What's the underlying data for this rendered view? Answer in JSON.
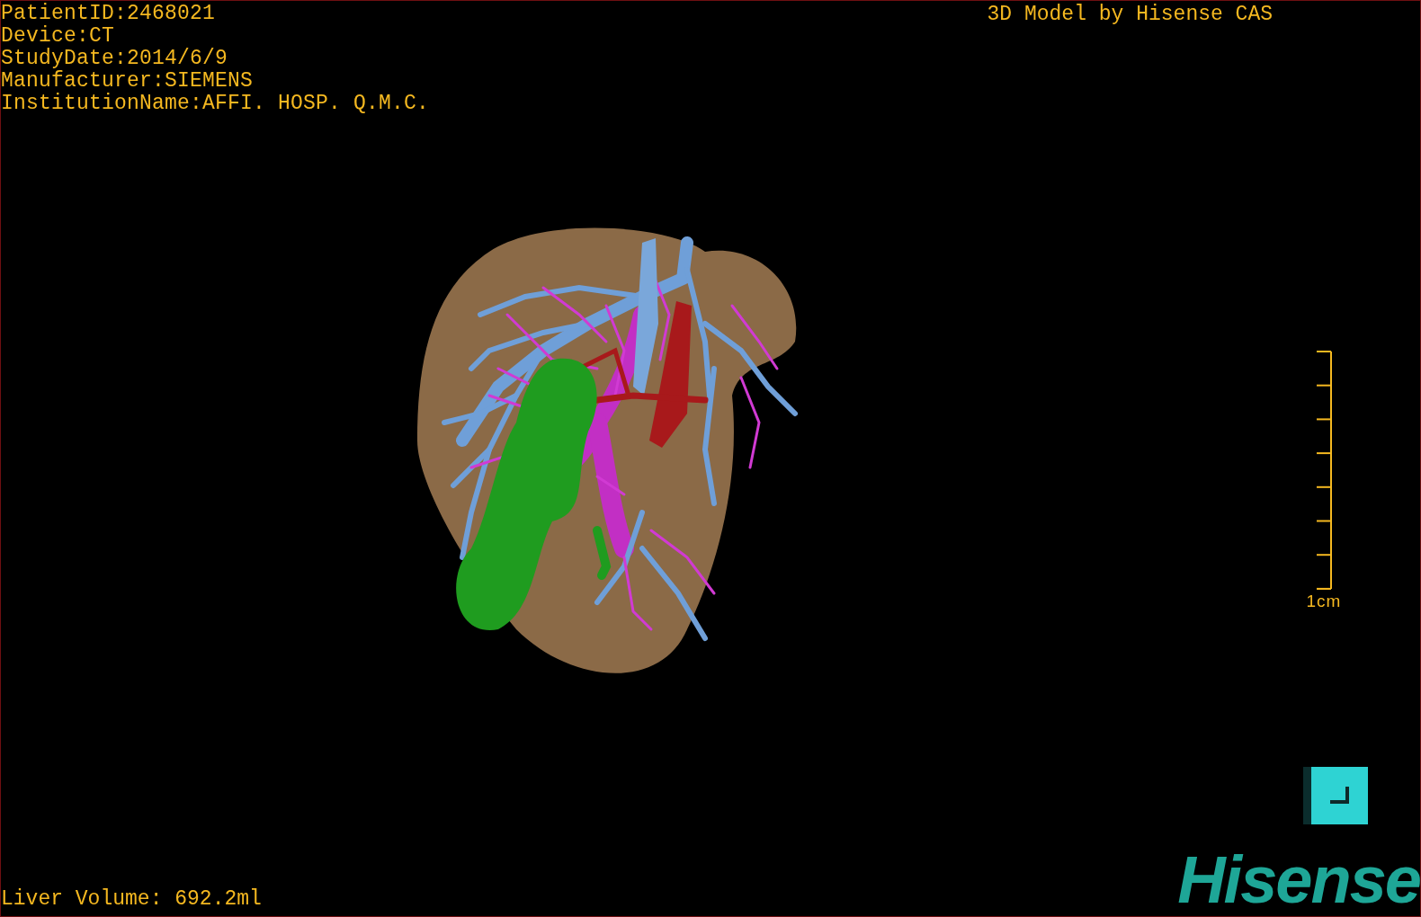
{
  "patient_info": [
    "PatientID:2468021",
    "Device:CT",
    "StudyDate:2014/6/9",
    "Manufacturer:SIEMENS",
    "InstitutionName:AFFI. HOSP. Q.M.C."
  ],
  "title": "3D Model by Hisense CAS",
  "scale_bar": {
    "label": "1cm"
  },
  "liver_volume": "Liver Volume: 692.2ml",
  "logo": "Hisense"
}
